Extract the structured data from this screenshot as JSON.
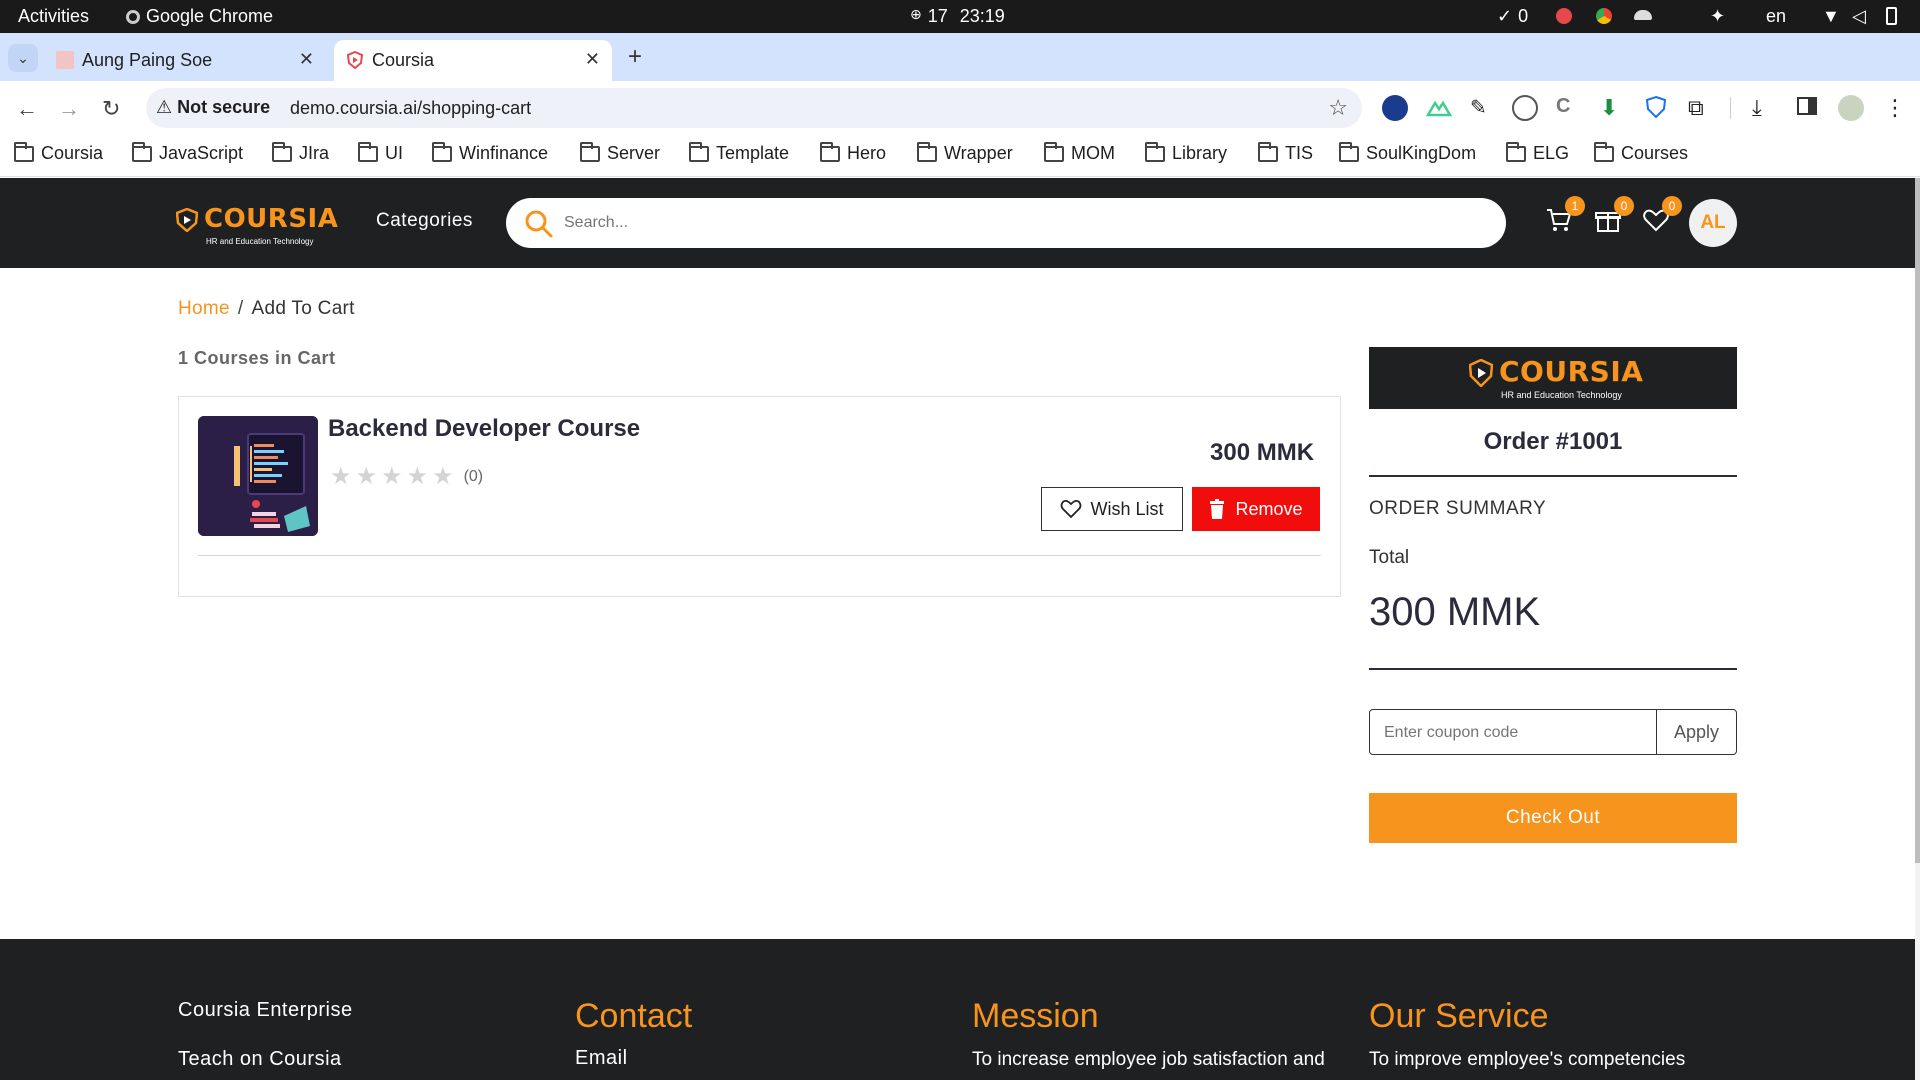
{
  "os": {
    "activities": "Activities",
    "app_name": "Google Chrome",
    "clock_date": "17",
    "clock_time": "23:19",
    "check_count": "0",
    "language": "en"
  },
  "browser": {
    "tabs": [
      {
        "title": "Aung Paing Soe",
        "active": false
      },
      {
        "title": "Coursia",
        "active": true
      }
    ],
    "security_label": "Not secure",
    "url": "demo.coursia.ai/shopping-cart",
    "bookmarks": [
      "Coursia",
      "JavaScript",
      "JIra",
      "UI",
      "Winfinance",
      "Server",
      "Template",
      "Hero",
      "Wrapper",
      "MOM",
      "Library",
      "TIS",
      "SoulKingDom",
      "ELG",
      "Courses"
    ]
  },
  "site": {
    "logo_text": "COURSIA",
    "logo_tagline": "HR and Education Technology",
    "nav_categories": "Categories",
    "search_placeholder": "Search...",
    "cart_count": "1",
    "gift_count": "0",
    "wishlist_count": "0",
    "avatar_initials": "AL"
  },
  "breadcrumb": {
    "home": "Home",
    "separator": "/",
    "current": "Add To Cart"
  },
  "cart": {
    "count_label": "1 Courses in Cart",
    "items": [
      {
        "title": "Backend Developer Course",
        "rating_count": "(0)",
        "stars": 0,
        "price": "300 MMK",
        "wishlist_label": "Wish List",
        "remove_label": "Remove"
      }
    ]
  },
  "order": {
    "number": "Order #1001",
    "summary_label": "ORDER SUMMARY",
    "total_label": "Total",
    "total_value": "300 MMK",
    "coupon_placeholder": "Enter coupon code",
    "apply_label": "Apply",
    "checkout_label": "Check Out"
  },
  "footer": {
    "links": [
      "Coursia Enterprise",
      "Teach on Coursia"
    ],
    "contact_heading": "Contact",
    "contact_email_label": "Email",
    "mission_heading": "Mession",
    "mission_text": "To increase employee job satisfaction and",
    "service_heading": "Our Service",
    "service_text": "To improve employee's competencies"
  },
  "colors": {
    "brand_orange": "#f7941d",
    "header_dark": "#1f2022",
    "remove_red": "#f20d0d",
    "tabstrip_blue": "#d3e3fd"
  }
}
